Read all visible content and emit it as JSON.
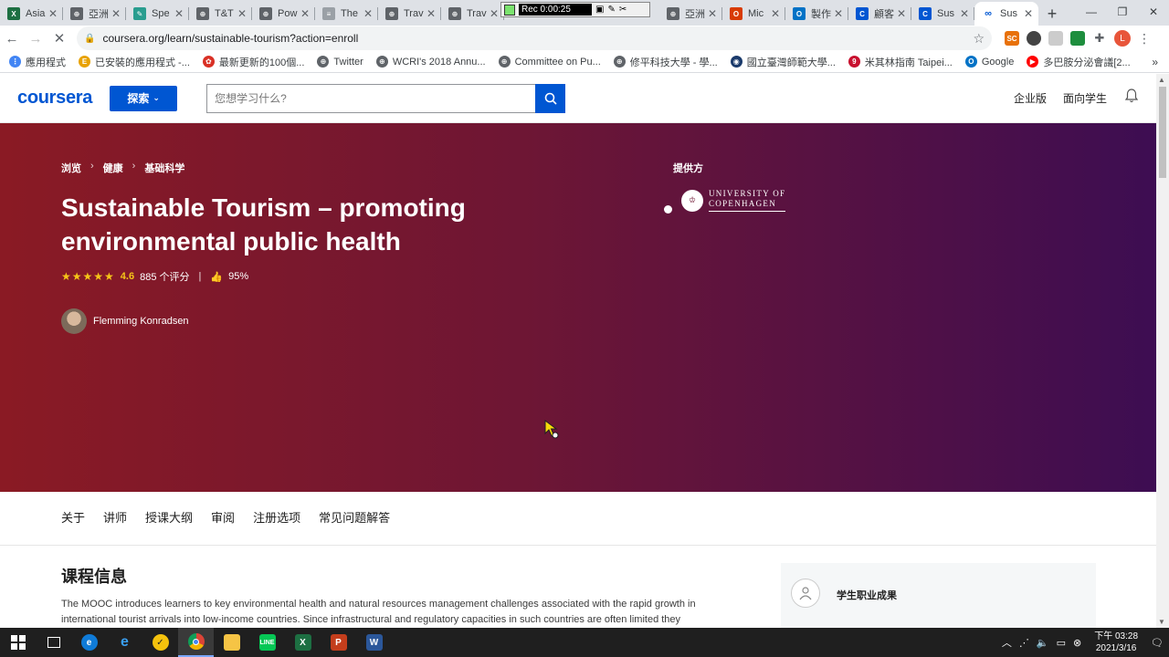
{
  "browser": {
    "tabs": [
      {
        "title": "Asia",
        "icon": "excel-icon",
        "color": "#1d6f42",
        "glyph": "X"
      },
      {
        "title": "亞洲",
        "icon": "globe-icon",
        "color": "#5f6368",
        "glyph": "⊕"
      },
      {
        "title": "Spe",
        "icon": "feather-icon",
        "color": "#2a9d8f",
        "glyph": "✎"
      },
      {
        "title": "T&T",
        "icon": "globe-icon",
        "color": "#5f6368",
        "glyph": "⊕"
      },
      {
        "title": "Pow",
        "icon": "globe-icon",
        "color": "#5f6368",
        "glyph": "⊕"
      },
      {
        "title": "The",
        "icon": "doc-icon",
        "color": "#9aa0a6",
        "glyph": "≡"
      },
      {
        "title": "Trav",
        "icon": "globe-icon",
        "color": "#5f6368",
        "glyph": "⊕"
      },
      {
        "title": "Trav",
        "icon": "globe-icon",
        "color": "#5f6368",
        "glyph": "⊕"
      }
    ],
    "tabs_right": [
      {
        "title": "亞洲",
        "icon": "globe-icon",
        "color": "#5f6368",
        "glyph": "⊕"
      },
      {
        "title": "Mic",
        "icon": "office-icon",
        "color": "#d83b01",
        "glyph": "O"
      },
      {
        "title": "製作",
        "icon": "outlook-icon",
        "color": "#0072c6",
        "glyph": "O"
      },
      {
        "title": "顧客",
        "icon": "coursera-c-icon",
        "color": "#0056d2",
        "glyph": "C"
      },
      {
        "title": "Sus",
        "icon": "coursera-c-icon",
        "color": "#0056d2",
        "glyph": "C"
      }
    ],
    "active_tab": {
      "title": "Sus",
      "icon": "coursera-loading-icon",
      "color": "#0056d2",
      "glyph": "∞"
    },
    "rec_label": "Rec 0:00:25",
    "url": "coursera.org/learn/sustainable-tourism?action=enroll",
    "bookmarks": [
      {
        "label": "應用程式",
        "icon": "apps-icon",
        "color": "#4285f4",
        "glyph": "⋮"
      },
      {
        "label": "已安裝的應用程式 -...",
        "icon": "e-icon",
        "color": "#e8a200",
        "glyph": "E"
      },
      {
        "label": "最新更新的100個...",
        "icon": "paw-icon",
        "color": "#d93025",
        "glyph": "✿"
      },
      {
        "label": "Twitter",
        "icon": "globe-icon",
        "color": "#5f6368",
        "glyph": "⊕"
      },
      {
        "label": "WCRI's 2018 Annu...",
        "icon": "globe-icon",
        "color": "#5f6368",
        "glyph": "⊕"
      },
      {
        "label": "Committee on Pu...",
        "icon": "globe-icon",
        "color": "#5f6368",
        "glyph": "⊕"
      },
      {
        "label": "修平科技大學 - 學...",
        "icon": "globe-icon",
        "color": "#5f6368",
        "glyph": "⊕"
      },
      {
        "label": "國立臺灣師範大學...",
        "icon": "ntnu-icon",
        "color": "#1a3a6b",
        "glyph": "◉"
      },
      {
        "label": "米其林指南 Taipei...",
        "icon": "michelin-icon",
        "color": "#c8102e",
        "glyph": "9"
      },
      {
        "label": "Google",
        "icon": "outlook-icon",
        "color": "#0072c6",
        "glyph": "O"
      },
      {
        "label": "多巴胺分泌會議[2...",
        "icon": "youtube-icon",
        "color": "#ff0000",
        "glyph": "▶"
      }
    ]
  },
  "coursera": {
    "logo": "coursera",
    "explore": "探索",
    "search_placeholder": "您想学习什么?",
    "enterprise": "企业版",
    "students": "面向学生"
  },
  "hero": {
    "breadcrumbs": [
      "浏览",
      "健康",
      "基础科学"
    ],
    "title": "Sustainable Tourism – promoting environmental public health",
    "stars": "★★★★★",
    "rating": "4.6",
    "reviews": "885 个评分",
    "like_percent": "95%",
    "instructor": "Flemming Konradsen",
    "provider_label": "提供方",
    "provider_name_line1": "UNIVERSITY OF",
    "provider_name_line2": "COPENHAGEN"
  },
  "section_nav": [
    "关于",
    "讲师",
    "授课大纲",
    "审阅",
    "注册选项",
    "常见问题解答"
  ],
  "content": {
    "heading": "课程信息",
    "about": "The MOOC introduces learners to key environmental health and natural resources management challenges associated with the rapid growth in international tourist arrivals into low-income countries. Since infrastructural and regulatory capacities in such countries are often limited they",
    "side_label": "学生职业成果"
  },
  "taskbar": {
    "time": "下午 03:28",
    "date": "2021/3/16"
  }
}
